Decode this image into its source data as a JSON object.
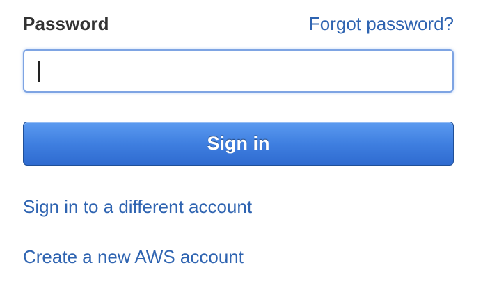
{
  "password_field": {
    "label": "Password",
    "forgot_link": "Forgot password?",
    "value": "",
    "placeholder": ""
  },
  "signin_button": {
    "label": "Sign in"
  },
  "links": {
    "different_account": "Sign in to a different account",
    "create_account": "Create a new AWS account"
  },
  "colors": {
    "link": "#2f64b1",
    "button": "#3f7fe0",
    "label": "#333333",
    "input_focus_border": "#7ea4e3"
  }
}
